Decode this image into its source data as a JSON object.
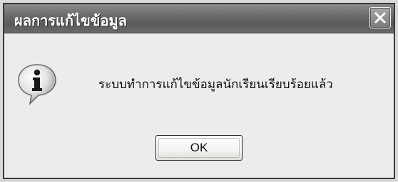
{
  "dialog": {
    "title": "ผลการแก้ไขข้อมูล",
    "close_icon": "close-icon",
    "message_icon": "info-icon",
    "message": "ระบบทำการแก้ไขข้อมูลนักเรียนเรียบร้อยแล้ว",
    "ok_label": "OK"
  }
}
